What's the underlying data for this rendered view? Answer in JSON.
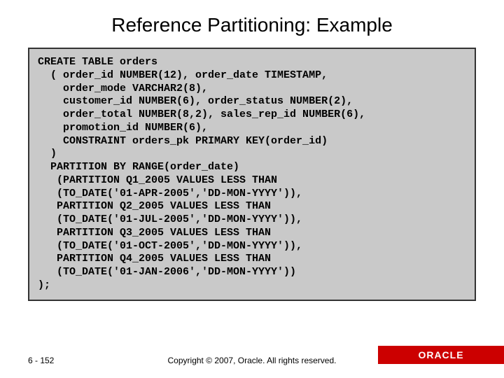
{
  "slide": {
    "title": "Reference Partitioning: Example",
    "code": "CREATE TABLE orders\n  ( order_id NUMBER(12), order_date TIMESTAMP,\n    order_mode VARCHAR2(8),\n    customer_id NUMBER(6), order_status NUMBER(2),\n    order_total NUMBER(8,2), sales_rep_id NUMBER(6),\n    promotion_id NUMBER(6),\n    CONSTRAINT orders_pk PRIMARY KEY(order_id)\n  )\n  PARTITION BY RANGE(order_date)\n   (PARTITION Q1_2005 VALUES LESS THAN\n   (TO_DATE('01-APR-2005','DD-MON-YYYY')),\n   PARTITION Q2_2005 VALUES LESS THAN\n   (TO_DATE('01-JUL-2005','DD-MON-YYYY')),\n   PARTITION Q3_2005 VALUES LESS THAN\n   (TO_DATE('01-OCT-2005','DD-MON-YYYY')),\n   PARTITION Q4_2005 VALUES LESS THAN\n   (TO_DATE('01-JAN-2006','DD-MON-YYYY'))\n);",
    "page_number": "6 - 152",
    "copyright": "Copyright © 2007, Oracle. All rights reserved.",
    "brand": "ORACLE"
  }
}
